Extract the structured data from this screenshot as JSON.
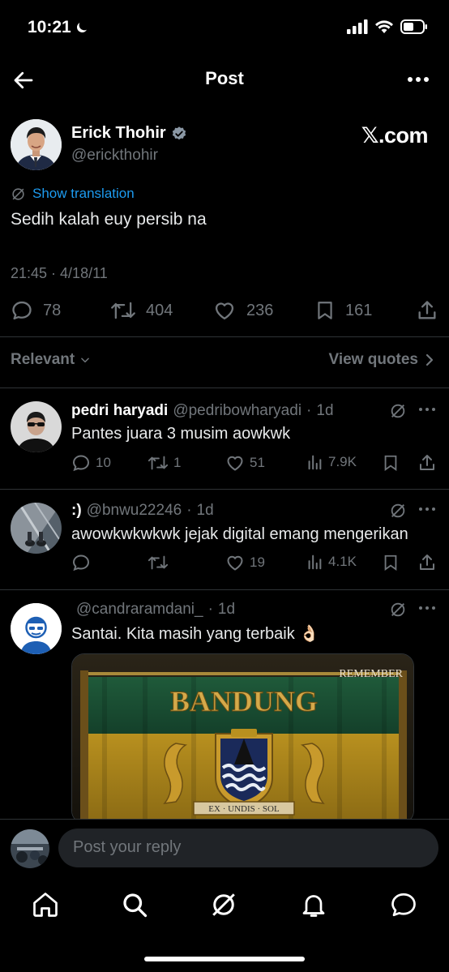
{
  "status_bar": {
    "time": "10:21"
  },
  "header": {
    "title": "Post"
  },
  "post": {
    "author_name": "Erick Thohir",
    "author_handle": "@erickthohir",
    "watermark": "𝕏.com",
    "show_translation": "Show translation",
    "text": "Sedih kalah euy persib na",
    "timestamp": "21:45 · 4/18/11",
    "stats": {
      "replies": "78",
      "reposts": "404",
      "likes": "236",
      "bookmarks": "161"
    }
  },
  "sort": {
    "label": "Relevant",
    "view_quotes": "View quotes"
  },
  "replies": [
    {
      "name": "pedri haryadi",
      "handle": "@pedribowharyadi",
      "age": "1d",
      "text": "Pantes juara 3 musim aowkwk",
      "replies": "10",
      "reposts": "1",
      "likes": "51",
      "views": "7.9K"
    },
    {
      "name": ":)",
      "handle": "@bnwu22246",
      "age": "1d",
      "text": "awowkwkwkwk jejak digital emang mengerikan",
      "replies": "",
      "reposts": "",
      "likes": "19",
      "views": "4.1K"
    },
    {
      "name": "",
      "handle": "@candraramdani_",
      "age": "1d",
      "text": "Santai. Kita masih yang terbaik 👌🏻",
      "image": {
        "brand": "REMEMBER",
        "title": "BANDUNG",
        "motto": "EX · UNDIS · SOL"
      }
    }
  ],
  "composer": {
    "placeholder": "Post your reply"
  },
  "colors": {
    "background": "#000000",
    "text": "#e7e9ea",
    "muted": "#71767b",
    "accent": "#1d9bf0",
    "divider": "#2f3336"
  },
  "icons": [
    "back-arrow-icon",
    "more-icon",
    "verified-icon",
    "grok-icon",
    "reply-icon",
    "repost-icon",
    "like-icon",
    "bookmark-icon",
    "share-icon",
    "views-icon",
    "home-icon",
    "search-icon",
    "notifications-icon",
    "messages-icon"
  ]
}
